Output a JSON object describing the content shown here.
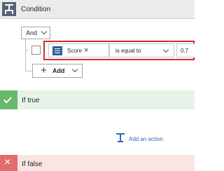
{
  "condition": {
    "title": "Condition",
    "icon": "condition-icon",
    "group_operator": "And",
    "checkbox_checked": false,
    "row": {
      "field_token": "Score",
      "field_icon": "variable-token-icon",
      "remove_glyph": "×",
      "operator": "is equal to",
      "value": "0.7"
    },
    "add_button": {
      "plus": "+",
      "label": "Add"
    },
    "highlight_color": "#d52b2b"
  },
  "if_true": {
    "title": "If true",
    "status_color": "#67b96b",
    "add_action_label": "Add an action"
  },
  "if_false": {
    "title": "If false",
    "close_glyph": "×",
    "status_color": "#e36c6c"
  }
}
